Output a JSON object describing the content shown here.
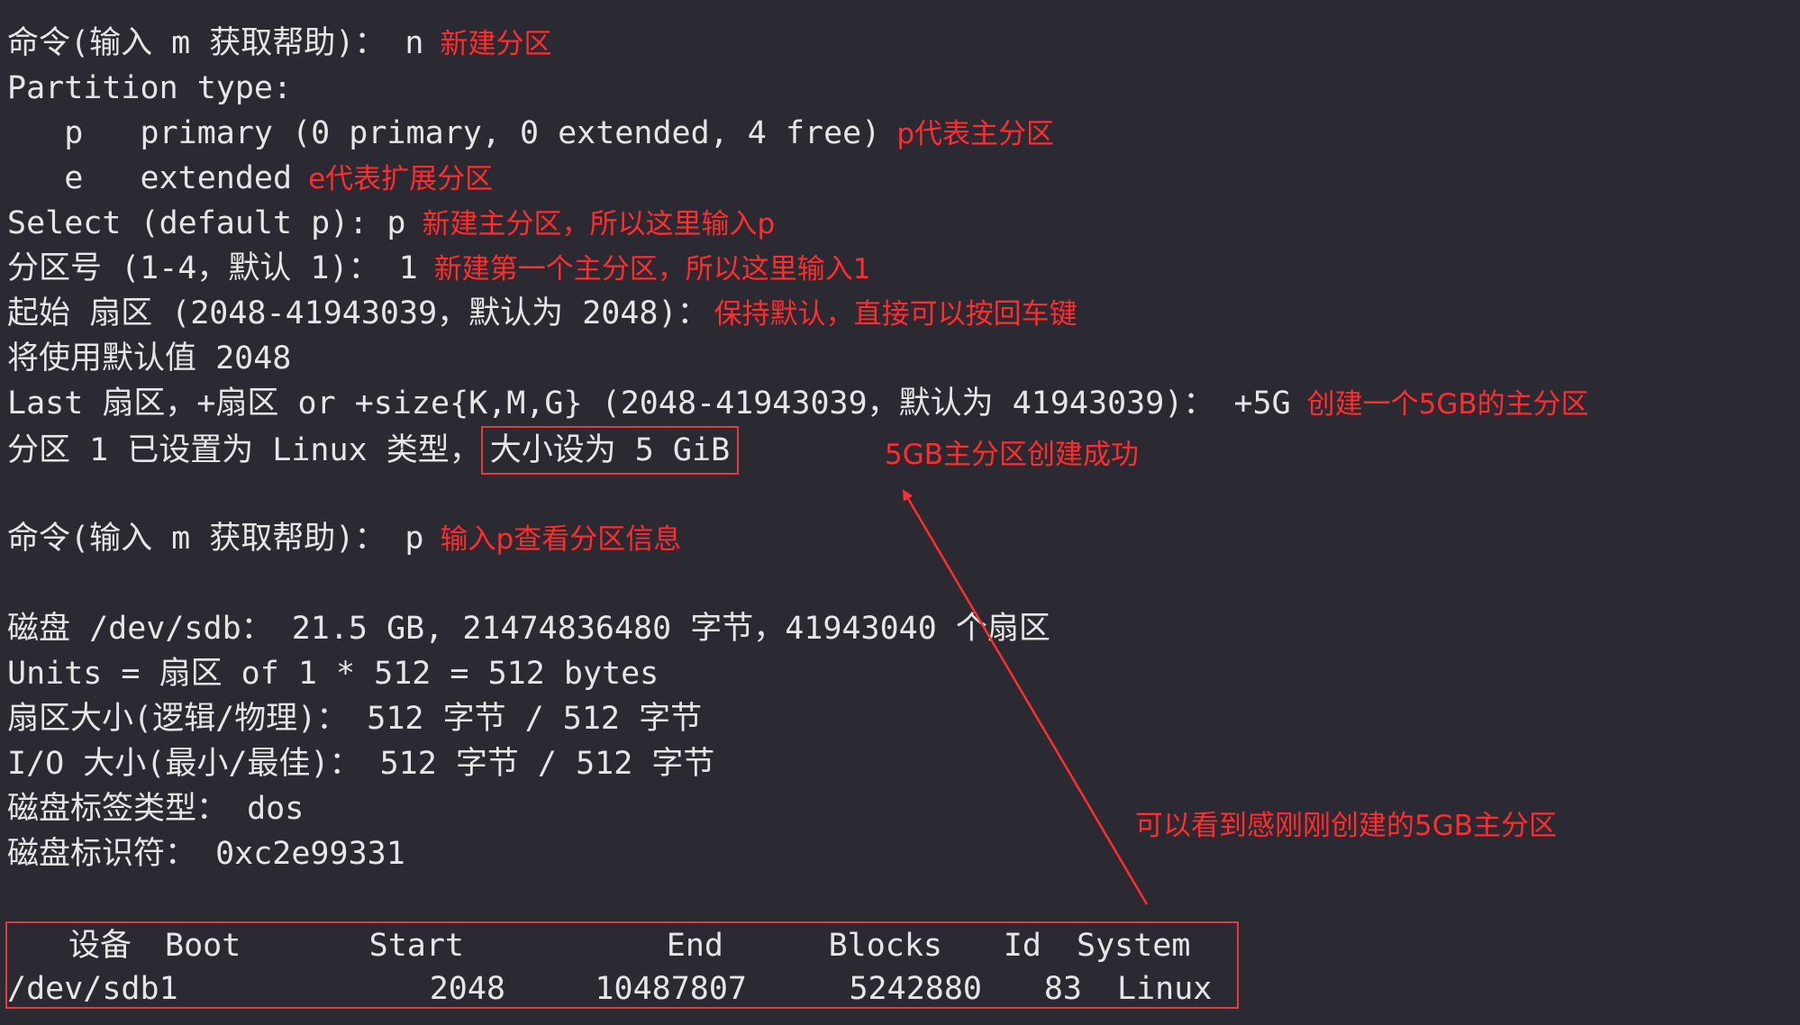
{
  "lines": [
    {
      "text": "命令(输入 m 获取帮助)： n",
      "note": "新建分区"
    },
    {
      "text": "Partition type:",
      "note": ""
    },
    {
      "text": "   p   primary (0 primary, 0 extended, 4 free)",
      "note": "p代表主分区"
    },
    {
      "text": "   e   extended",
      "note": "e代表扩展分区"
    },
    {
      "text": "Select (default p): p",
      "note": "新建主分区，所以这里输入p"
    },
    {
      "text": "分区号 (1-4，默认 1)： 1",
      "note": "新建第一个主分区，所以这里输入1"
    },
    {
      "text": "起始 扇区 (2048-41943039，默认为 2048)：",
      "note": "保持默认，直接可以按回车键"
    },
    {
      "text": "将使用默认值 2048",
      "note": ""
    },
    {
      "text": "Last 扇区，+扇区 or +size{K,M,G} (2048-41943039，默认为 41943039)： +5G",
      "note": "创建一个5GB的主分区"
    },
    {
      "text": "分区 1 已设置为 Linux 类型，",
      "boxed": "大小设为 5 GiB",
      "note": "5GB主分区创建成功"
    },
    {
      "text": "命令(输入 m 获取帮助)： p",
      "note": "输入p查看分区信息"
    },
    {
      "text": "磁盘 /dev/sdb： 21.5 GB, 21474836480 字节，41943040 个扇区",
      "note": ""
    },
    {
      "text": "Units = 扇区 of 1 * 512 = 512 bytes",
      "note": ""
    },
    {
      "text": "扇区大小(逻辑/物理)： 512 字节 / 512 字节",
      "note": ""
    },
    {
      "text": "I/O 大小(最小/最佳)： 512 字节 / 512 字节",
      "note": ""
    },
    {
      "text": "磁盘标签类型： dos",
      "note": ""
    },
    {
      "text": "磁盘标识符： 0xc2e99331",
      "note": ""
    }
  ],
  "partition_table": {
    "headers": {
      "device": "设备",
      "boot": "Boot",
      "start": "Start",
      "end": "End",
      "blocks": "Blocks",
      "id": "Id",
      "system": "System"
    },
    "rows": [
      {
        "device": "/dev/sdb1",
        "boot": "",
        "start": "2048",
        "end": "10487807",
        "blocks": "5242880",
        "id": "83",
        "system": "Linux"
      }
    ]
  },
  "callout": {
    "text": "可以看到感刚刚创建的5GB主分区"
  },
  "colors": {
    "background": "#2b2a33",
    "terminal_text": "#e6e6e6",
    "annotation": "#ff2d2d",
    "box": "#e33c3c"
  }
}
